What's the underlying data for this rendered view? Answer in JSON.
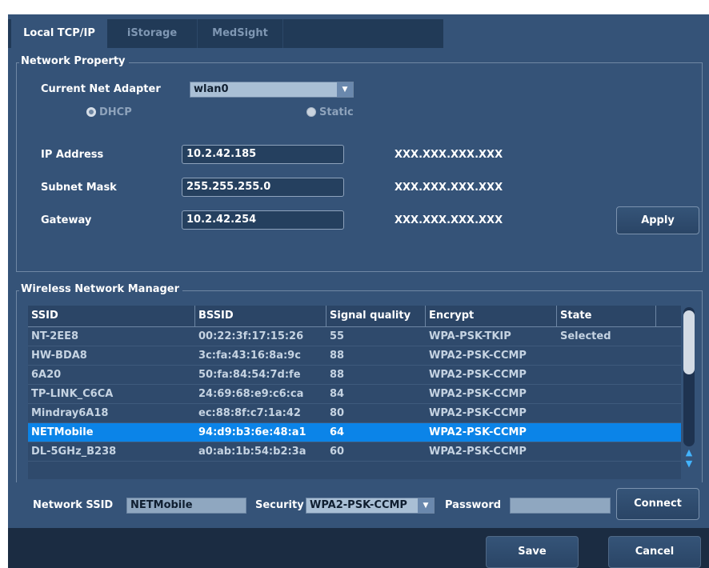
{
  "tabs": [
    {
      "label": "Local TCP/IP",
      "active": true
    },
    {
      "label": "iStorage",
      "active": false
    },
    {
      "label": "MedSight",
      "active": false
    }
  ],
  "network_property": {
    "title": "Network Property",
    "adapter_label": "Current Net Adapter",
    "adapter_value": "wlan0",
    "dhcp_label": "DHCP",
    "static_label": "Static",
    "selected_mode": "DHCP",
    "ip_label": "IP Address",
    "ip_value": "10.2.42.185",
    "subnet_label": "Subnet Mask",
    "subnet_value": "255.255.255.0",
    "gateway_label": "Gateway",
    "gateway_value": "10.2.42.254",
    "format_hint": "XXX.XXX.XXX.XXX",
    "apply_label": "Apply"
  },
  "wireless": {
    "title": "Wireless Network Manager",
    "columns": [
      "SSID",
      "BSSID",
      "Signal quality",
      "Encrypt",
      "State"
    ],
    "rows": [
      {
        "ssid": "NT-2EE8",
        "bssid": "00:22:3f:17:15:26",
        "signal": "55",
        "encrypt": "WPA-PSK-TKIP",
        "state": "Selected",
        "selected": false
      },
      {
        "ssid": "HW-BDA8",
        "bssid": "3c:fa:43:16:8a:9c",
        "signal": "88",
        "encrypt": "WPA2-PSK-CCMP",
        "state": "",
        "selected": false
      },
      {
        "ssid": "6A20",
        "bssid": "50:fa:84:54:7d:fe",
        "signal": "88",
        "encrypt": "WPA2-PSK-CCMP",
        "state": "",
        "selected": false
      },
      {
        "ssid": "TP-LINK_C6CA",
        "bssid": "24:69:68:e9:c6:ca",
        "signal": "84",
        "encrypt": "WPA2-PSK-CCMP",
        "state": "",
        "selected": false
      },
      {
        "ssid": "Mindray6A18",
        "bssid": "ec:88:8f:c7:1a:42",
        "signal": "80",
        "encrypt": "WPA2-PSK-CCMP",
        "state": "",
        "selected": false
      },
      {
        "ssid": "NETMobile",
        "bssid": "94:d9:b3:6e:48:a1",
        "signal": "64",
        "encrypt": "WPA2-PSK-CCMP",
        "state": "",
        "selected": true
      },
      {
        "ssid": "DL-5GHz_B238",
        "bssid": "a0:ab:1b:54:b2:3a",
        "signal": "60",
        "encrypt": "WPA2-PSK-CCMP",
        "state": "",
        "selected": false
      }
    ],
    "ssid_label": "Network SSID",
    "ssid_value": "NETMobile",
    "security_label": "Security",
    "security_value": "WPA2-PSK-CCMP",
    "password_label": "Password",
    "password_value": "",
    "connect_label": "Connect"
  },
  "footer": {
    "save_label": "Save",
    "cancel_label": "Cancel"
  },
  "icons": {
    "dropdown": "chevron-down-icon",
    "scroll_up": "arrow-up-icon",
    "scroll_down": "arrow-down-icon"
  }
}
